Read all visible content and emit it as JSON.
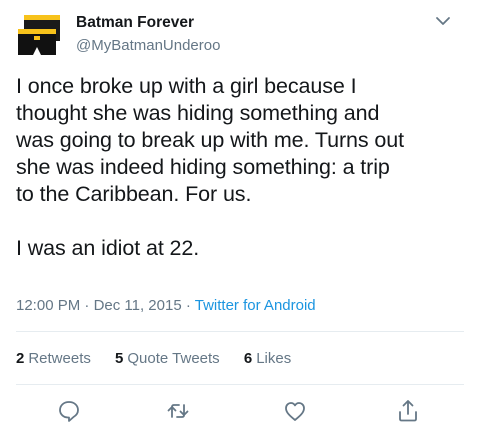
{
  "author": {
    "name": "Batman Forever",
    "handle": "@MyBatmanUnderoo"
  },
  "tweet": {
    "lines": [
      "I once broke up with a girl because I",
      "thought she was hiding something and",
      "was going to break up with me. Turns out",
      "she was indeed hiding something: a trip",
      "to the Caribbean. For us.",
      "I was an idiot at 22."
    ]
  },
  "meta": {
    "time": "12:00 PM",
    "separator": " · ",
    "date": "Dec 11, 2015",
    "source": "Twitter for Android"
  },
  "stats": {
    "retweets_count": "2",
    "retweets_label": "Retweets",
    "quotes_count": "5",
    "quotes_label": "Quote Tweets",
    "likes_count": "6",
    "likes_label": "Likes"
  },
  "actions": {
    "icons": [
      "reply-icon",
      "retweet-icon",
      "like-icon",
      "share-icon"
    ]
  },
  "colors": {
    "text": "#14171a",
    "secondary": "#657786",
    "link": "#1b95e0",
    "divider": "#e6ecf0",
    "avatar_yellow": "#f7c21b"
  }
}
